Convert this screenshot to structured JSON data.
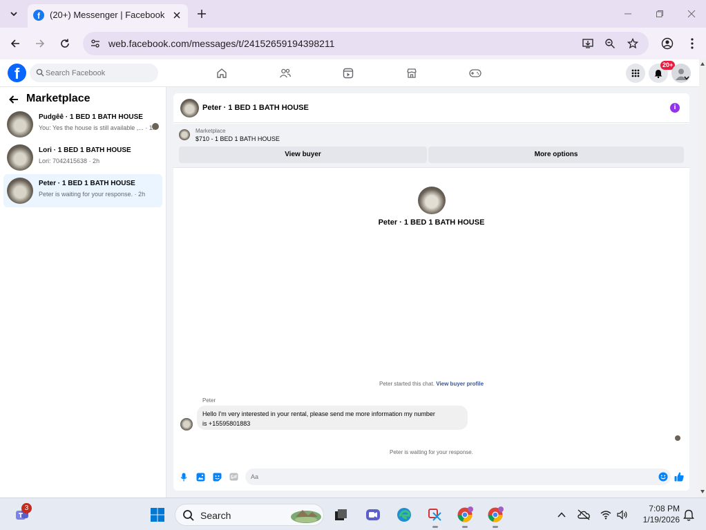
{
  "browser": {
    "tab_title": "(20+) Messenger | Facebook",
    "url": "web.facebook.com/messages/t/24152659194398211"
  },
  "fb": {
    "logo": "f",
    "search_placeholder": "Search Facebook",
    "notif_badge": "20+"
  },
  "left_panel": {
    "title": "Marketplace",
    "conversations": [
      {
        "name": "Pudgêê · 1 BED 1 BATH HOUSE",
        "snippet": "You: Yes the house is still available ,... · 1h",
        "active": false
      },
      {
        "name": "Lori · 1 BED 1 BATH HOUSE",
        "snippet": "Lori: 7042415638 · 2h",
        "active": false
      },
      {
        "name": "Peter · 1 BED 1 BATH HOUSE",
        "snippet": "Peter is waiting for your response. · 2h",
        "active": true
      }
    ]
  },
  "chat": {
    "header_name": "Peter · 1 BED 1 BATH HOUSE",
    "info_glyph": "i",
    "listing_label": "Marketplace",
    "listing_title": "$710 - 1 BED 1 BATH HOUSE",
    "view_buyer_label": "View buyer",
    "more_options_label": "More options",
    "center_name": "Peter · 1 BED 1 BATH HOUSE",
    "started_text": "Peter started this chat. ",
    "started_link": "View buyer profile",
    "sender_label": "Peter",
    "message_line1": "Hello I'm very interested in your rental, please send me more information my number",
    "message_line2": "is +15595801883",
    "waiting_text": "Peter is waiting for your response.",
    "compose_placeholder": "Aa"
  },
  "taskbar": {
    "search_label": "Search",
    "teams_badge": "3",
    "time": "7:08 PM",
    "date": "1/19/2026"
  },
  "colors": {
    "fb_blue": "#0866ff",
    "messenger_blue": "#0084ff",
    "badge_red": "#e41e3f",
    "info_purple": "#9333ea"
  }
}
